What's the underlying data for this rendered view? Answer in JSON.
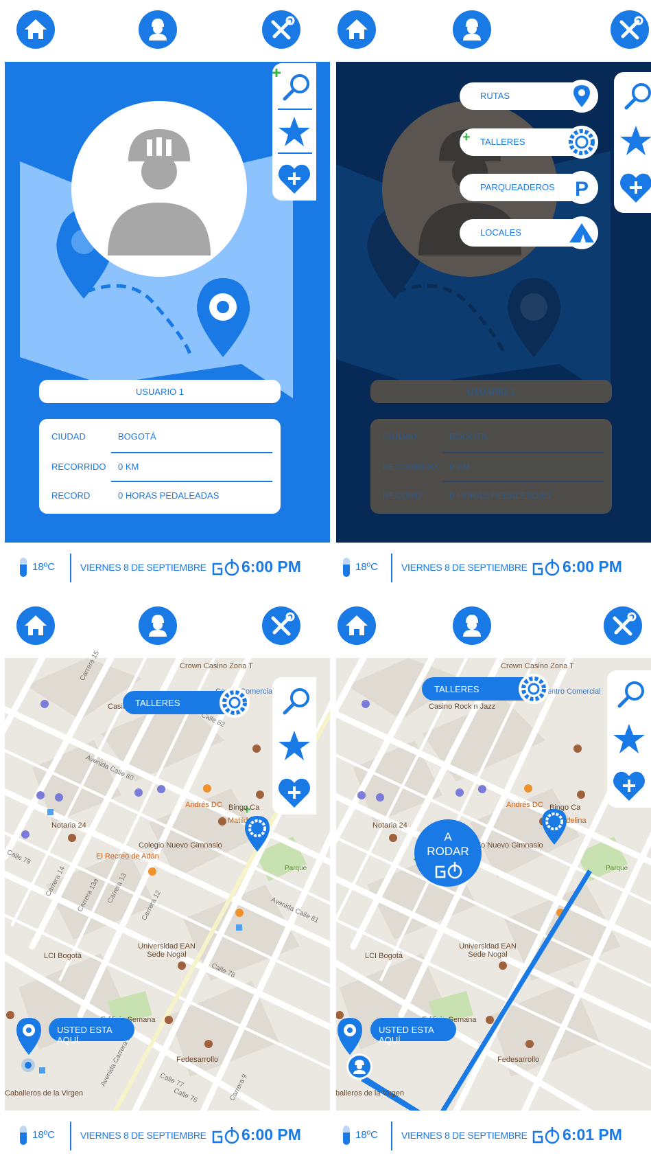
{
  "status": {
    "temperature": "18ºC",
    "date": "VIERNES 8 DE SEPTIEMBRE",
    "time_a": "6:00 PM",
    "time_b": "6:01 PM"
  },
  "profile": {
    "username": "USUARIO 1",
    "rows": [
      {
        "label": "CIUDAD",
        "value": "BOGOTÁ"
      },
      {
        "label": "RECORRIDO",
        "value": "0 KM"
      },
      {
        "label": "RECORD",
        "value": "0 HORAS PEDALEADAS"
      }
    ]
  },
  "menu": {
    "items": [
      {
        "label": "RUTAS",
        "icon": "map-pin-icon"
      },
      {
        "label": "TALLERES",
        "icon": "gear-ring-icon"
      },
      {
        "label": "PARQUEADEROS",
        "icon": "parking-icon"
      },
      {
        "label": "LOCALES",
        "icon": "tent-icon"
      }
    ]
  },
  "map": {
    "filter_label": "TALLERES",
    "you_are_here": "USTED ESTA AQUÍ",
    "ride_button": {
      "line1": "A",
      "line2": "RODAR"
    },
    "places": [
      "Crown Casino Zona T",
      "Casino Rock n Jazz",
      "Centro Comercial",
      "Andrés DC",
      "Bingo Ca",
      "Matildelina",
      "Notaria 24",
      "Colegio Nuevo Gimnasio",
      "El Recreo de Adán",
      "Parque",
      "Universidad EAN Sede Nogal",
      "LCI Bogotá",
      "Edificio Semana",
      "Fedesarrollo",
      "Caballeros de la Virgen"
    ],
    "streets": [
      "Carrera 15",
      "Calle 82",
      "Avenida Calle 80",
      "Calle 79",
      "Carrera 14",
      "Carrera 13a",
      "Carrera 13",
      "Carrera 12",
      "Avenida Calle 81",
      "Calle 78",
      "Avenida Carrera 11",
      "Calle 77",
      "Calle 76",
      "Carrera 9"
    ]
  },
  "colors": {
    "primary": "#1a7ae5",
    "dark_overlay": "#062a55",
    "light_blue": "#8cc3ff",
    "gray": "#a7a7a7",
    "green": "#3bb54a"
  }
}
